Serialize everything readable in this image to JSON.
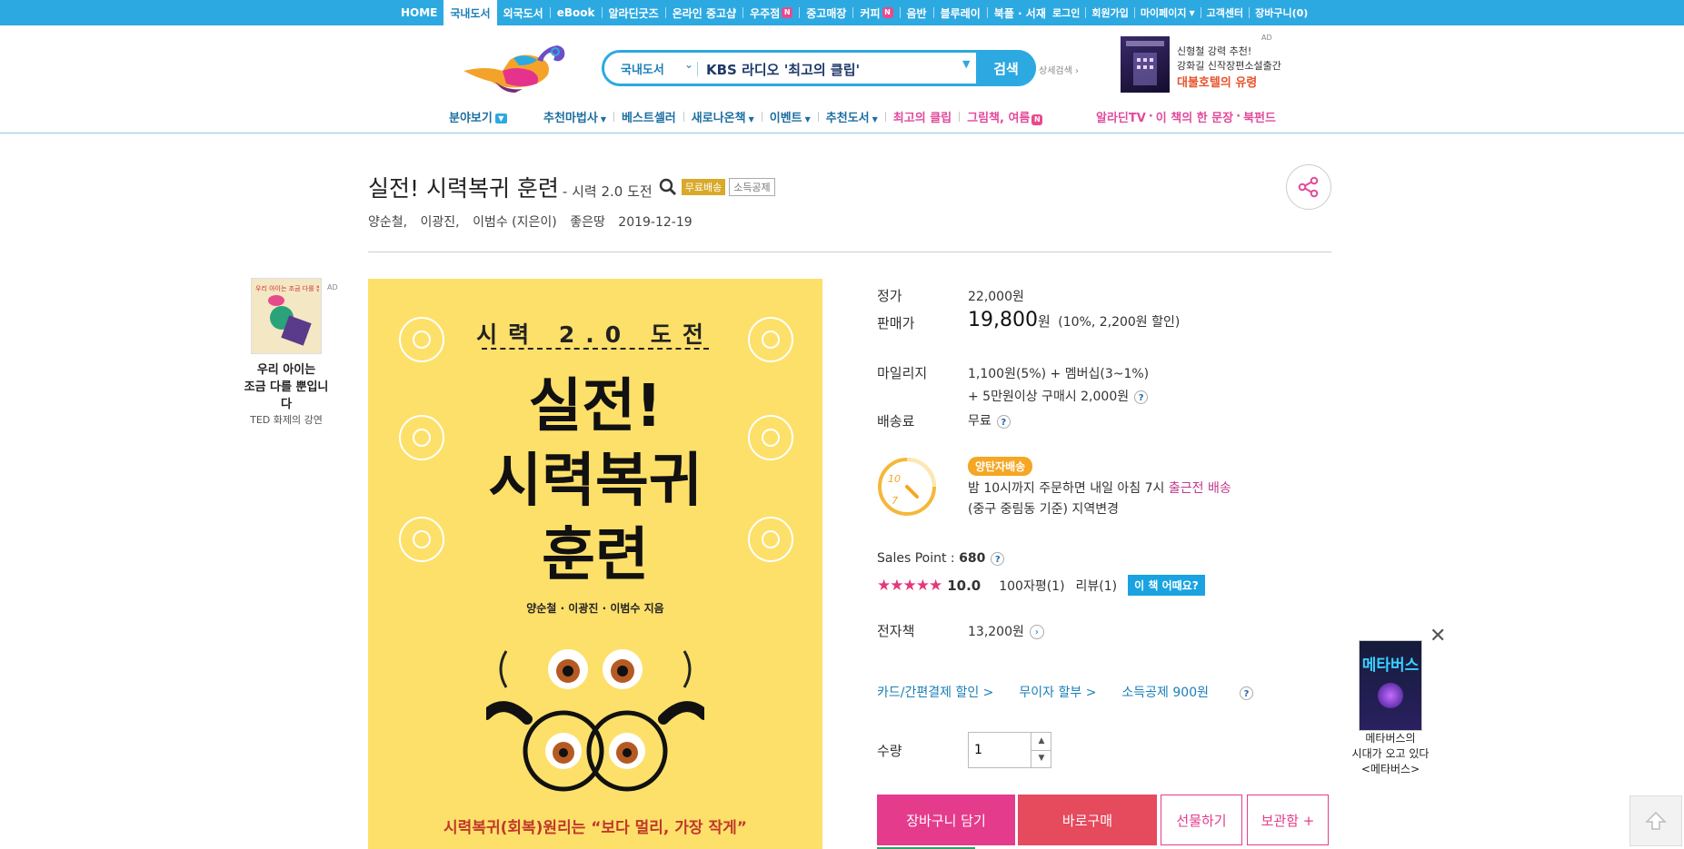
{
  "topnav": {
    "items": [
      {
        "label": "HOME"
      },
      {
        "label": "국내도서",
        "active": true
      },
      {
        "label": "외국도서"
      },
      {
        "label": "eBook"
      },
      {
        "label": "알라딘굿즈"
      },
      {
        "label": "온라인 중고샵"
      },
      {
        "label": "우주점",
        "badge": "N"
      },
      {
        "label": "중고매장"
      },
      {
        "label": "커피",
        "badge": "N"
      },
      {
        "label": "음반"
      },
      {
        "label": "블루레이"
      },
      {
        "label": "북플 · 서재"
      }
    ],
    "util": [
      "로그인",
      "회원가입",
      "마이페이지",
      "고객센터",
      "장바구니(0)"
    ]
  },
  "search": {
    "category": "국내도서",
    "query": "KBS 라디오 '최고의 클립'",
    "button": "검색",
    "advanced": "상세검색"
  },
  "header_ad": {
    "tag": "AD",
    "book_title": "대불호텔의 유령",
    "line1": "신형철 강력 추천!",
    "line2": "강화길 신작장편소설출간",
    "line3": "대불호텔의 유령"
  },
  "gnb": {
    "items": [
      "분야보기",
      "추천마법사",
      "베스트셀러",
      "새로나온책",
      "이벤트",
      "추천도서",
      "최고의 클립",
      "그림책, 여름"
    ],
    "right": [
      "알라딘TV",
      "이 책의 한 문장",
      "북펀드"
    ],
    "new_badge": "N"
  },
  "book": {
    "title": "실전! 시력복귀 훈련",
    "subtitle": "- 시력 2.0 도전",
    "tags": [
      "무료배송",
      "소득공제"
    ],
    "authors": [
      "양순철,",
      "이광진,",
      "이범수 (지은이)"
    ],
    "publisher": "좋은땅",
    "date": "2019-12-19"
  },
  "cover": {
    "top_label": "시력 2.0 도전",
    "big1": "실전!",
    "big2": "시력복귀",
    "big3": "훈련",
    "authors": "양순철 · 이광진 · 이범수 지음",
    "slogan": "시력복귀(회복)원리는 “보다 멀리, 가장 작게”"
  },
  "left_ad": {
    "tag": "AD",
    "cover_text": "우리 아이는 조금 다를 뿐입니다",
    "line1": "우리 아이는",
    "line2": "조금 다를 뿐입니다",
    "line3": "TED 화제의 강연"
  },
  "info": {
    "list_price_label": "정가",
    "list_price": "22,000원",
    "sale_price_label": "판매가",
    "sale_price": "19,800",
    "sale_unit": "원",
    "discount": "(10%, 2,200원 할인)",
    "mileage_label": "마일리지",
    "mileage1": "1,100원(5%) + 멤버십(3~1%)",
    "mileage2": "+ 5만원이상 구매시 2,000원",
    "shipping_label": "배송료",
    "shipping": "무료",
    "delivery_badge": "양탄자배송",
    "delivery_line1": "밤 10시까지 주문하면 내일 아침 7시",
    "delivery_highlight": "출근전 배송",
    "delivery_line2": "(중구 중림동 기준) 지역변경",
    "clock_10": "10",
    "clock_7": "7",
    "salespoint_label": "Sales Point :",
    "salespoint_value": "680",
    "rating": 10.0,
    "rating_text": "10.0",
    "stars": "★★★★★",
    "reviews_100": "100자평(1)",
    "reviews": "리뷰(1)",
    "how_button": "이 책 어때요?",
    "ebook_label": "전자책",
    "ebook_price": "13,200원",
    "links": [
      "카드/간편결제 할인 >",
      "무이자 할부 >",
      "소득공제 900원"
    ],
    "qty_label": "수량",
    "qty_value": "1"
  },
  "actions": {
    "cart": "장바구니 담기",
    "buy": "바로구매",
    "gift": "선물하기",
    "save": "보관함 +"
  },
  "right_ad": {
    "cover_title": "메타버스",
    "line1": "메타버스의",
    "line2": "시대가 오고 있다",
    "line3": "<메타버스>"
  },
  "colors": {
    "brand_blue": "#2da9e1",
    "pink": "#e53b8c",
    "buy_red": "#e54a5d",
    "cover_yellow": "#fde06a"
  }
}
